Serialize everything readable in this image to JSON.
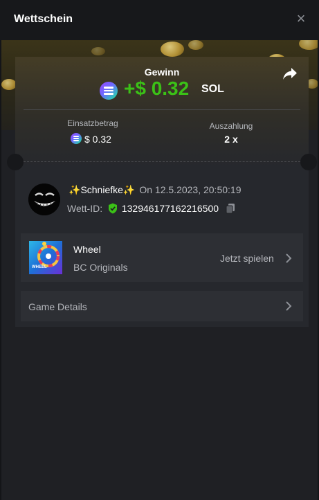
{
  "header": {
    "title": "Wettschein",
    "close_icon": "close-icon"
  },
  "result": {
    "label": "Gewinn",
    "amount": "+$ 0.32",
    "currency": "SOL",
    "amount_color": "#3bc117"
  },
  "stats": {
    "bet_label": "Einsatzbetrag",
    "bet_value": "$ 0.32",
    "payout_label": "Auszahlung",
    "payout_value": "2 x"
  },
  "player": {
    "name": "Schniefke",
    "time": "On 12.5.2023, 20:50:19",
    "bet_id_label": "Wett-ID:",
    "bet_id": "132946177162216500"
  },
  "game": {
    "name": "Wheel",
    "provider": "BC Originals",
    "play_label": "Jetzt spielen",
    "thumb_text": "WHEEL"
  },
  "details": {
    "label": "Game Details"
  }
}
